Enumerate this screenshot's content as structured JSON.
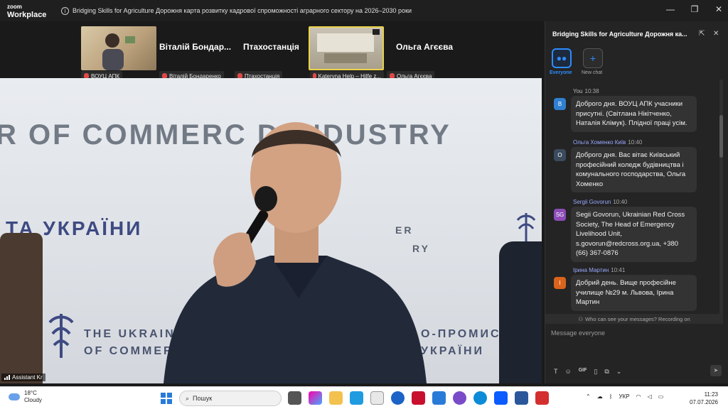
{
  "app": {
    "brand_line1": "zoom",
    "brand_line2": "Workplace",
    "window_title": "Bridging Skills for Agriculture  Дорожня карта розвитку кадрової спроможності аграрного сектору на 2026–2030 роки",
    "controls": [
      "minimize",
      "restore",
      "close"
    ]
  },
  "strip": {
    "tiles": [
      {
        "tag": "ВОУЦ АПК",
        "name": ""
      },
      {
        "tag": "Віталій Бондаренко",
        "name": "Віталій Бондар..."
      },
      {
        "tag": "Птахостанція",
        "name": "Птахостанція"
      },
      {
        "tag": "Kateryna Help – Hilfe z...",
        "name": ""
      },
      {
        "tag": "Ольга Агєєва",
        "name": "Ольга Агєєва"
      }
    ]
  },
  "video": {
    "bg_line1": "R OF COMMERC   D INDUSTRY",
    "bg_line2": "ТА УКРАЇНИ",
    "bg_line3": "THE UKRAINIA",
    "bg_line4": "OF COMMERCI",
    "bg_line5": "О-ПРОМИСЛОВ",
    "bg_line6": "УКРАЇНИ",
    "bg_line7": "ER",
    "bg_line8": "RY",
    "speaker": "Assistant Kr"
  },
  "chat": {
    "title": "Bridging Skills for Agriculture  Дорожня ка...",
    "tab_everyone": "Everyone",
    "tab_new": "New chat",
    "messages": [
      {
        "sender": "You",
        "time": "10:38",
        "avatar": "B",
        "text": "Доброго дня. ВОУЦ АПК учасники присутні. (Світлана Нікітченко, Наталія Клімук). Плідної праці усім."
      },
      {
        "sender": "Ольга Хоменко Київ",
        "time": "10:40",
        "avatar": "O",
        "text": "Доброго дня. Вас вітає Київський професійний коледж будівництва і комунального господарства, Ольга Хоменко"
      },
      {
        "sender": "Sergii Govorun",
        "time": "10:40",
        "avatar": "SG",
        "text": "Segii Govorun, Ukrainian Red Cross Society, The Head of Emergency Livelihood Unit, s.govorun@redcross.org.ua, +380 (66) 367-0876"
      },
      {
        "sender": "Ірина Мартин",
        "time": "10:41",
        "avatar": "I",
        "text": "Добрий день. Вище професійне училище №29 м. Львова, Ірина Мартин"
      }
    ],
    "visibility_note": "Who can see your messages? Recording on",
    "input_placeholder": "Message everyone",
    "tool_gif": "GIF"
  },
  "taskbar": {
    "temperature": "18°C",
    "weather": "Cloudy",
    "search_placeholder": "Пошук",
    "lang": "УКР",
    "time": "11:23",
    "date": "07.07.2026"
  },
  "colors": {
    "accent": "#2d8cff",
    "panel": "#242424",
    "bubble": "#333333"
  }
}
